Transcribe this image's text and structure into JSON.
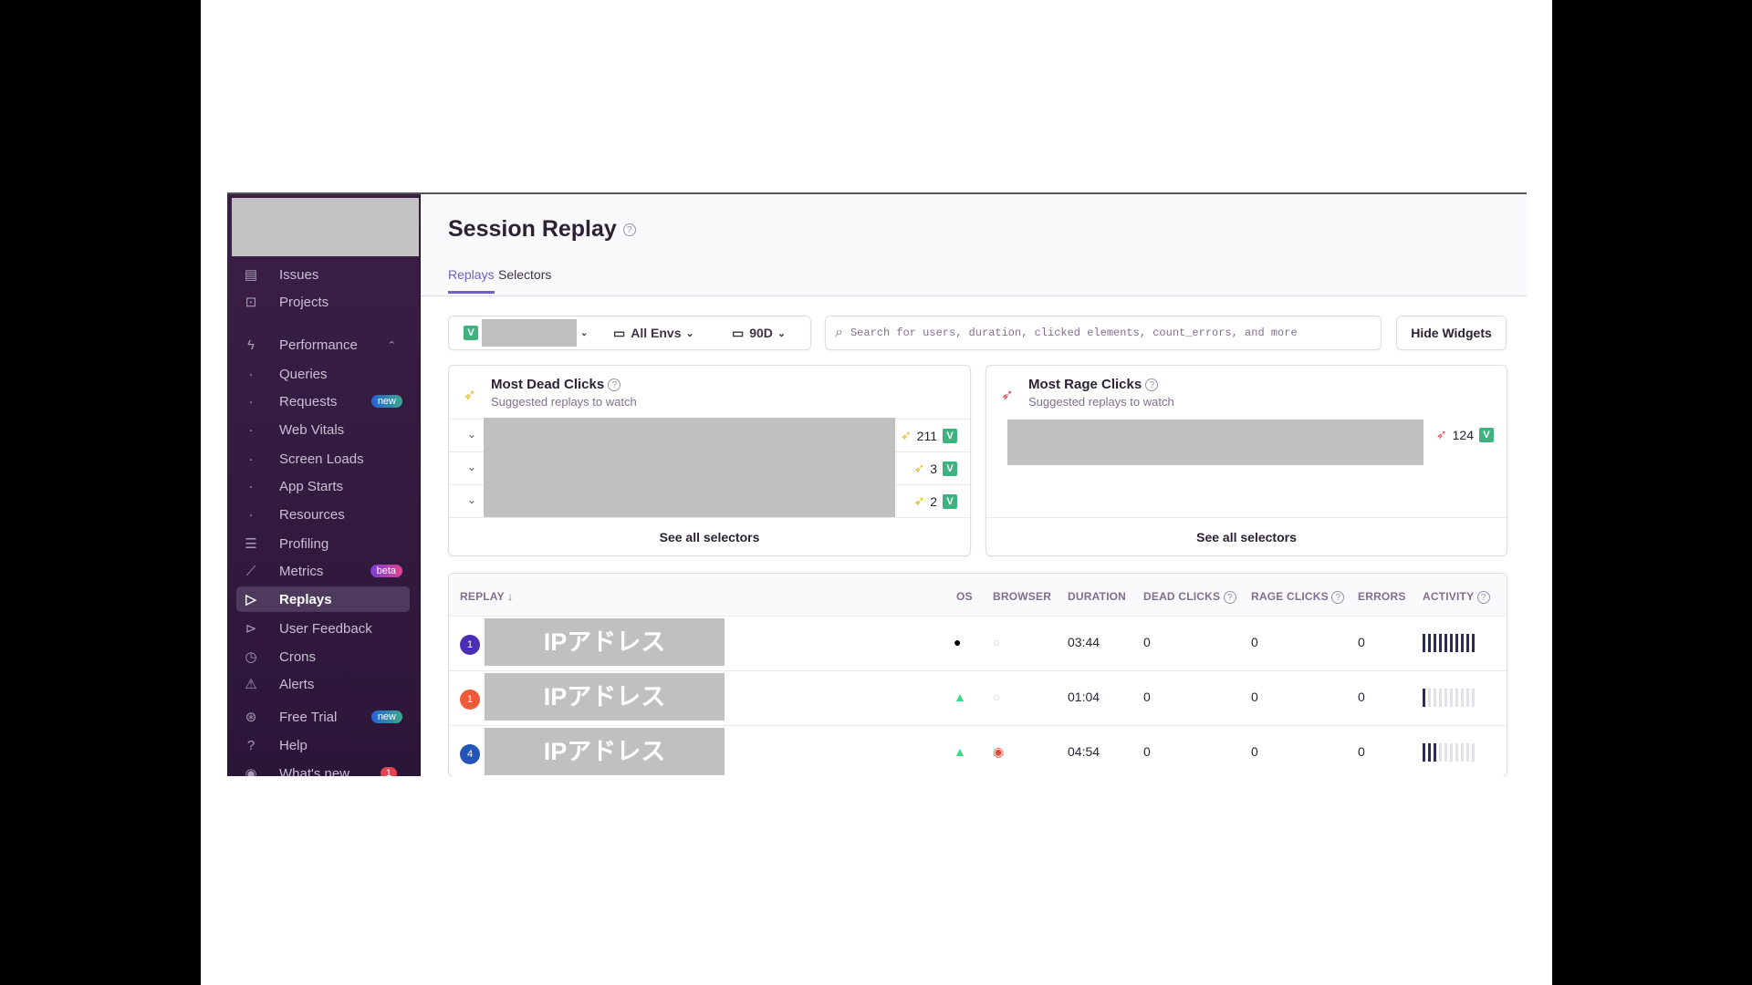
{
  "sidebar": {
    "items": [
      {
        "label": "Issues",
        "icon": "inbox-icon"
      },
      {
        "label": "Projects",
        "icon": "folder-code-icon"
      },
      {
        "label": "Performance",
        "icon": "lightning-icon"
      },
      {
        "label": "Queries"
      },
      {
        "label": "Requests",
        "badge": "new"
      },
      {
        "label": "Web Vitals"
      },
      {
        "label": "Screen Loads"
      },
      {
        "label": "App Starts"
      },
      {
        "label": "Resources"
      },
      {
        "label": "Profiling",
        "icon": "profiling-icon"
      },
      {
        "label": "Metrics",
        "badge": "beta",
        "icon": "chart-line-icon"
      },
      {
        "label": "Replays",
        "icon": "play-icon",
        "active": true
      },
      {
        "label": "User Feedback",
        "icon": "megaphone-icon"
      },
      {
        "label": "Crons",
        "icon": "history-icon"
      },
      {
        "label": "Alerts",
        "icon": "siren-icon"
      },
      {
        "label": "Free Trial",
        "badge": "new",
        "icon": "lightning-circle-icon"
      },
      {
        "label": "Help",
        "icon": "question-icon"
      },
      {
        "label": "What's new",
        "badge": "1",
        "icon": "broadcast-icon"
      }
    ]
  },
  "header": {
    "title": "Session Replay",
    "help": "?",
    "tabs": [
      "Replays",
      "Selectors"
    ]
  },
  "toolbar": {
    "env": "All Envs",
    "period": "90D",
    "search_placeholder": "Search for users, duration, clicked elements, count_errors, and more",
    "hide_widgets": "Hide Widgets",
    "vue": "V"
  },
  "widgets": [
    {
      "title": "Most Dead Clicks",
      "subtitle": "Suggested replays to watch",
      "rows": [
        "211",
        "3",
        "2"
      ],
      "see_all": "See all selectors",
      "color": "#e9b91a"
    },
    {
      "title": "Most Rage Clicks",
      "subtitle": "Suggested replays to watch",
      "rows": [
        "124"
      ],
      "see_all": "See all selectors",
      "color": "#e5414d"
    }
  ],
  "table": {
    "columns": [
      "REPLAY ↓",
      "OS",
      "BROWSER",
      "DURATION",
      "DEAD CLICKS",
      "RAGE CLICKS",
      "ERRORS",
      "ACTIVITY"
    ],
    "rows": [
      {
        "badge": "1",
        "badge_color": "#4a2fb5",
        "name": "IPアドレス",
        "os": "apple",
        "browser": "unknown",
        "duration": "03:44",
        "dead": "0",
        "rage": "0",
        "errors": "0",
        "activity": 10
      },
      {
        "badge": "1",
        "badge_color": "#ef5a3a",
        "name": "IPアドレス",
        "os": "android",
        "browser": "unknown",
        "duration": "01:04",
        "dead": "0",
        "rage": "0",
        "errors": "0",
        "activity": 1
      },
      {
        "badge": "4",
        "badge_color": "#2455b8",
        "name": "IPアドレス",
        "os": "android",
        "browser": "chrome",
        "duration": "04:54",
        "dead": "0",
        "rage": "0",
        "errors": "0",
        "activity": 3
      }
    ]
  }
}
